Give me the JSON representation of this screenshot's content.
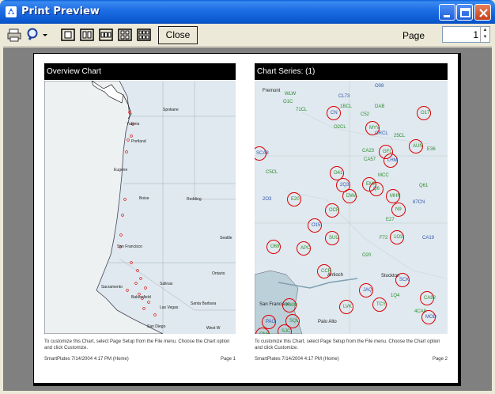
{
  "window": {
    "title": "Print Preview",
    "buttons": {
      "minimize": "minimize",
      "maximize": "maximize",
      "close": "close"
    }
  },
  "toolbar": {
    "icons": [
      "printer-icon",
      "zoom-icon",
      "one-page-icon",
      "two-pages-icon",
      "three-pages-icon",
      "four-pages-icon",
      "six-pages-icon"
    ],
    "close_label": "Close",
    "page_label": "Page",
    "page_value": "1"
  },
  "pages": [
    {
      "header": "Overview Chart",
      "map_labels": [
        "Spokane",
        "Yakima",
        "Portland",
        "Eugene",
        "Boise",
        "Redding",
        "San Francisco",
        "Sacramento",
        "Salinas",
        "Bakersfield",
        "Las Vegas",
        "Santa Barbara",
        "Ontario",
        "San Diego",
        "West W",
        "Seattle"
      ],
      "footnote": "To customize this Chart, select Page Setup from the File menu.  Choose the Chart option and click Customize.",
      "meta": "SmartPlates 7/14/2004 4:17 PM (Home)",
      "page": "Page 1"
    },
    {
      "header": "Chart Series:  (1)",
      "station_codes": [
        "O08",
        "WLW",
        "O1C",
        "71CL",
        "CL73",
        "1BCL",
        "DAB",
        "O17",
        "CN",
        "C52",
        "O2CL",
        "MYV",
        "ORCL",
        "25CL",
        "AUN",
        "E36",
        "SCA8",
        "CA23",
        "CA57",
        "GFL",
        "LHM",
        "C5CL",
        "O41",
        "MCC",
        "2Q3",
        "EMP",
        "Q6",
        "Q61",
        "2O3",
        "E20",
        "DWA",
        "MHR",
        "87CN",
        "OCR",
        "N9",
        "E27",
        "O15",
        "SUU",
        "F72",
        "1O3",
        "CA19",
        "O69",
        "APC",
        "CCR",
        "JAQ",
        "O20",
        "LVK",
        "TCY",
        "SCK",
        "1Q4",
        "CA92",
        "4CA8",
        "MOD",
        "HWD",
        "SQL",
        "SJC",
        "PAO",
        "ON5",
        "Antioch",
        "Stockton",
        "San Francisco",
        "Palo Alto",
        "Fremont"
      ],
      "footnote": "To customize this Chart, select Page Setup from the File menu.  Choose the Chart option and click Customize.",
      "meta": "SmartPlates 7/14/2004 4:17 PM (Home)",
      "page": "Page 2"
    }
  ]
}
